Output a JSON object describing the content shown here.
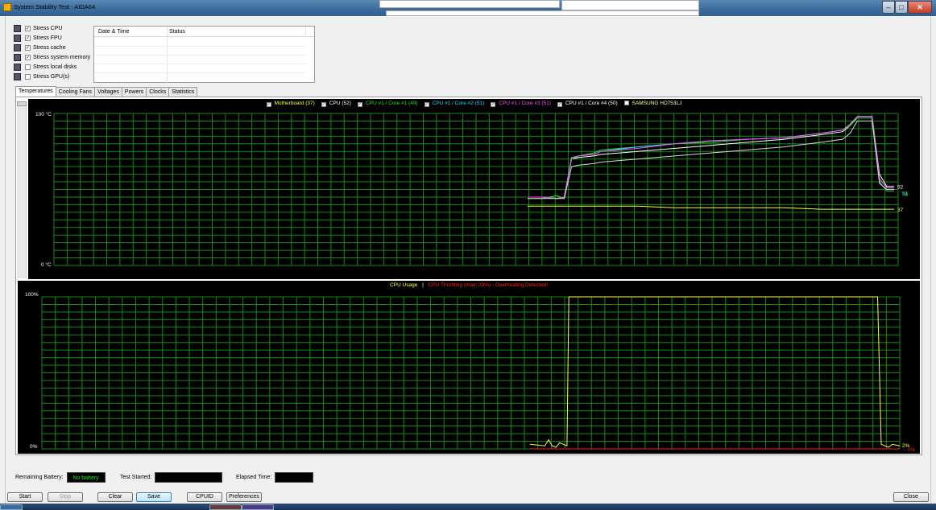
{
  "window": {
    "title": "System Stability Test - AIDA64"
  },
  "options": [
    {
      "label": "Stress CPU",
      "checked": true,
      "icon": "cpu-icon"
    },
    {
      "label": "Stress FPU",
      "checked": true,
      "icon": "fpu-icon"
    },
    {
      "label": "Stress cache",
      "checked": true,
      "icon": "cache-icon"
    },
    {
      "label": "Stress system memory",
      "checked": true,
      "icon": "memory-icon"
    },
    {
      "label": "Stress local disks",
      "checked": false,
      "icon": "disk-icon"
    },
    {
      "label": "Stress GPU(s)",
      "checked": false,
      "icon": "gpu-icon"
    }
  ],
  "log": {
    "col_date": "Date & Time",
    "col_status": "Status"
  },
  "tabs": [
    "Temperatures",
    "Cooling Fans",
    "Voltages",
    "Powers",
    "Clocks",
    "Statistics"
  ],
  "temp_chart": {
    "y_max_label": "100 °C",
    "y_min_label": "0 °C",
    "legend": [
      {
        "label": "Motherboard (37)",
        "color": "#ffff40",
        "checked": true
      },
      {
        "label": "CPU (52)",
        "color": "#ffffff",
        "checked": true
      },
      {
        "label": "CPU #1 / Core #1 (49)",
        "color": "#21e021",
        "checked": true
      },
      {
        "label": "CPU #1 / Core #2 (51)",
        "color": "#29d4ff",
        "checked": true
      },
      {
        "label": "CPU #1 / Core #3 (51)",
        "color": "#ff4dff",
        "checked": true
      },
      {
        "label": "CPU #1 / Core #4 (50)",
        "color": "#ffffff",
        "checked": true
      },
      {
        "label": "SAMSUNG HD753LJ",
        "color": "#ffffaa",
        "checked": false
      }
    ],
    "end_labels": {
      "motherboard": "37",
      "cpu": "52",
      "core1": "49",
      "core2": "51"
    }
  },
  "usage_chart": {
    "legend_usage": "CPU Usage",
    "legend_sep": "|",
    "legend_throttle": "CPU Throttling (max: 29%) - Overheating Detected!",
    "y_max_label": "100%",
    "y_min_label": "0%",
    "end_usage": "2%",
    "end_throttle": "0%"
  },
  "chart_data": [
    {
      "type": "line",
      "title": "",
      "ylim": [
        0,
        100
      ],
      "unit": "°C",
      "x": [
        0,
        4,
        8,
        10,
        12,
        14,
        18,
        20,
        30,
        40,
        50,
        60,
        70,
        80,
        86,
        88,
        90,
        92,
        94,
        96,
        98,
        100
      ],
      "series": [
        {
          "name": "Motherboard",
          "values": [
            39,
            39,
            39,
            39,
            39,
            39,
            39,
            39,
            39,
            38,
            38,
            38,
            38,
            37,
            37,
            37,
            37,
            37,
            37,
            37,
            37,
            37
          ]
        },
        {
          "name": "CPU",
          "values": [
            45,
            45,
            44,
            45,
            70,
            71,
            72,
            73,
            75,
            77,
            79,
            81,
            83,
            86,
            88,
            92,
            98,
            98,
            98,
            60,
            52,
            52
          ]
        },
        {
          "name": "CPU #1 / Core #1",
          "values": [
            44,
            44,
            46,
            44,
            70,
            72,
            74,
            76,
            78,
            80,
            81,
            83,
            84,
            87,
            89,
            92,
            97,
            97,
            97,
            55,
            49,
            49
          ]
        },
        {
          "name": "CPU #1 / Core #2",
          "values": [
            45,
            45,
            44,
            45,
            71,
            72,
            73,
            75,
            78,
            80,
            82,
            83,
            84,
            87,
            89,
            93,
            98,
            98,
            98,
            57,
            51,
            51
          ]
        },
        {
          "name": "CPU #1 / Core #3",
          "values": [
            45,
            45,
            44,
            45,
            71,
            72,
            73,
            75,
            77,
            80,
            82,
            83,
            84,
            87,
            89,
            93,
            98,
            98,
            98,
            57,
            51,
            51
          ]
        },
        {
          "name": "CPU #1 / Core #4",
          "values": [
            44,
            44,
            44,
            44,
            65,
            66,
            67,
            68,
            70,
            72,
            74,
            76,
            78,
            81,
            83,
            87,
            95,
            95,
            95,
            54,
            50,
            50
          ]
        }
      ]
    },
    {
      "type": "line",
      "title": "",
      "ylim": [
        0,
        100
      ],
      "unit": "%",
      "x": [
        0,
        4,
        5,
        6,
        7,
        8,
        9,
        10,
        10.5,
        20,
        40,
        60,
        80,
        90,
        94,
        95,
        96,
        97,
        98,
        100
      ],
      "series": [
        {
          "name": "CPU Usage",
          "values": [
            3,
            2,
            6,
            2,
            1,
            4,
            3,
            2,
            100,
            100,
            100,
            100,
            100,
            100,
            100,
            3,
            2,
            1,
            3,
            2
          ]
        },
        {
          "name": "CPU Throttling",
          "values": [
            0,
            0,
            0,
            0,
            0,
            0,
            0,
            0,
            0,
            0,
            0,
            0,
            0,
            0,
            0,
            0,
            0,
            0,
            0,
            0
          ]
        }
      ]
    }
  ],
  "status": {
    "battery_label": "Remaining Battery:",
    "battery_value": "No battery",
    "started_label": "Test Started:",
    "elapsed_label": "Elapsed Time:"
  },
  "buttons": {
    "start": "Start",
    "stop": "Stop",
    "clear": "Clear",
    "save": "Save",
    "cpuid": "CPUID",
    "preferences": "Preferences",
    "close": "Close"
  }
}
